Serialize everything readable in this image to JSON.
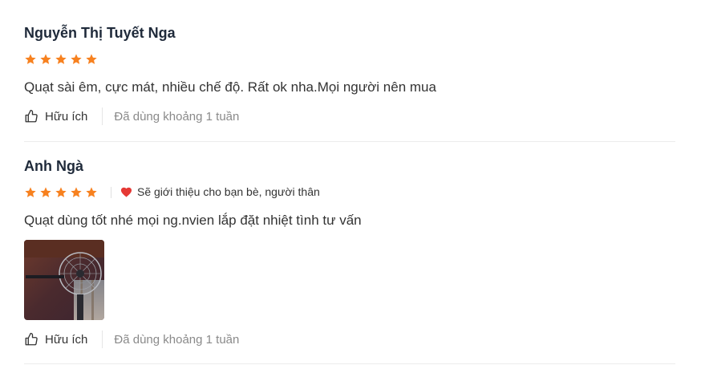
{
  "reviews": [
    {
      "name": "Nguyễn Thị Tuyết Nga",
      "rating": 5,
      "content": "Quạt sài êm, cực mát, nhiều chế độ. Rất ok nha.Mọi người nên mua",
      "helpful_label": "Hữu ích",
      "usage": "Đã dùng khoảng 1 tuần"
    },
    {
      "name": "Anh Ngà",
      "rating": 5,
      "badge": "Sẽ giới thiệu cho bạn bè, người thân",
      "content": "Quạt dùng tốt nhé mọi ng.nvien lắp đặt nhiệt tình tư vấn",
      "helpful_label": "Hữu ích",
      "usage": "Đã dùng khoảng 1 tuần"
    }
  ],
  "colors": {
    "star": "#f7811f",
    "heart": "#e53935",
    "text": "#333333",
    "muted": "#8a8a8a"
  },
  "icons": {
    "star": "star-icon",
    "heart": "heart-icon",
    "like": "thumbs-up-icon"
  }
}
